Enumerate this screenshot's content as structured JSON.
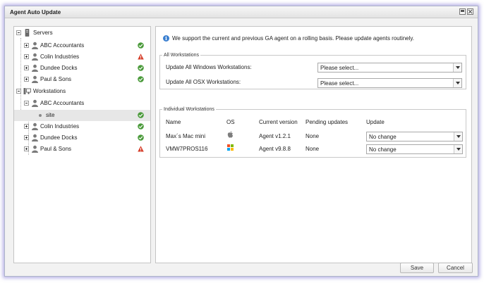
{
  "window": {
    "title": "Agent Auto Update"
  },
  "tree": {
    "servers_label": "Servers",
    "servers": [
      {
        "label": "ABC Accountants",
        "status": "ok"
      },
      {
        "label": "Colin Industries",
        "status": "warning"
      },
      {
        "label": "Dundee Docks",
        "status": "ok"
      },
      {
        "label": "Paul & Sons",
        "status": "ok"
      }
    ],
    "workstations_label": "Workstations",
    "workstations": [
      {
        "label": "ABC Accountants",
        "status": ""
      },
      {
        "label": "site",
        "status": "ok"
      },
      {
        "label": "Colin Industries",
        "status": "ok"
      },
      {
        "label": "Dundee Docks",
        "status": "ok"
      },
      {
        "label": "Paul & Sons",
        "status": "warning"
      }
    ]
  },
  "info": {
    "text": "We support the current and previous GA agent on a rolling basis. Please update agents routinely."
  },
  "all_workstations": {
    "legend": "All Workstations",
    "windows_label": "Update All Windows Workstations:",
    "windows_value": "Please select...",
    "osx_label": "Update All OSX Workstations:",
    "osx_value": "Please select..."
  },
  "individual": {
    "legend": "Individual Workstations",
    "headers": {
      "name": "Name",
      "os": "OS",
      "version": "Current version",
      "pending": "Pending updates",
      "update": "Update"
    },
    "rows": [
      {
        "name": "Max´s Mac mini",
        "os": "apple-icon",
        "version": "Agent v1.2.1",
        "pending": "None",
        "update": "No change"
      },
      {
        "name": "VMW7PROS116",
        "os": "windows-icon",
        "version": "Agent v9.8.8",
        "pending": "None",
        "update": "No change"
      }
    ]
  },
  "footer": {
    "save": "Save",
    "cancel": "Cancel"
  },
  "colors": {
    "ok": "#4a9a3a",
    "warning": "#d6402c",
    "info": "#3a7fd0"
  }
}
